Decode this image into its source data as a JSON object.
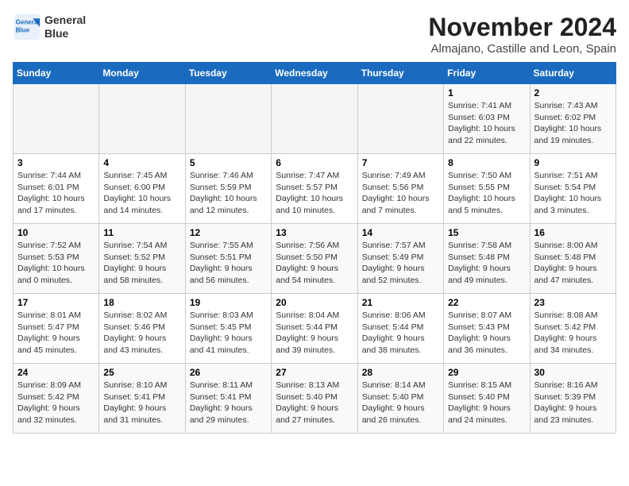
{
  "header": {
    "logo_line1": "General",
    "logo_line2": "Blue",
    "month": "November 2024",
    "location": "Almajano, Castille and Leon, Spain"
  },
  "weekdays": [
    "Sunday",
    "Monday",
    "Tuesday",
    "Wednesday",
    "Thursday",
    "Friday",
    "Saturday"
  ],
  "weeks": [
    [
      {
        "day": "",
        "info": ""
      },
      {
        "day": "",
        "info": ""
      },
      {
        "day": "",
        "info": ""
      },
      {
        "day": "",
        "info": ""
      },
      {
        "day": "",
        "info": ""
      },
      {
        "day": "1",
        "info": "Sunrise: 7:41 AM\nSunset: 6:03 PM\nDaylight: 10 hours and 22 minutes."
      },
      {
        "day": "2",
        "info": "Sunrise: 7:43 AM\nSunset: 6:02 PM\nDaylight: 10 hours and 19 minutes."
      }
    ],
    [
      {
        "day": "3",
        "info": "Sunrise: 7:44 AM\nSunset: 6:01 PM\nDaylight: 10 hours and 17 minutes."
      },
      {
        "day": "4",
        "info": "Sunrise: 7:45 AM\nSunset: 6:00 PM\nDaylight: 10 hours and 14 minutes."
      },
      {
        "day": "5",
        "info": "Sunrise: 7:46 AM\nSunset: 5:59 PM\nDaylight: 10 hours and 12 minutes."
      },
      {
        "day": "6",
        "info": "Sunrise: 7:47 AM\nSunset: 5:57 PM\nDaylight: 10 hours and 10 minutes."
      },
      {
        "day": "7",
        "info": "Sunrise: 7:49 AM\nSunset: 5:56 PM\nDaylight: 10 hours and 7 minutes."
      },
      {
        "day": "8",
        "info": "Sunrise: 7:50 AM\nSunset: 5:55 PM\nDaylight: 10 hours and 5 minutes."
      },
      {
        "day": "9",
        "info": "Sunrise: 7:51 AM\nSunset: 5:54 PM\nDaylight: 10 hours and 3 minutes."
      }
    ],
    [
      {
        "day": "10",
        "info": "Sunrise: 7:52 AM\nSunset: 5:53 PM\nDaylight: 10 hours and 0 minutes."
      },
      {
        "day": "11",
        "info": "Sunrise: 7:54 AM\nSunset: 5:52 PM\nDaylight: 9 hours and 58 minutes."
      },
      {
        "day": "12",
        "info": "Sunrise: 7:55 AM\nSunset: 5:51 PM\nDaylight: 9 hours and 56 minutes."
      },
      {
        "day": "13",
        "info": "Sunrise: 7:56 AM\nSunset: 5:50 PM\nDaylight: 9 hours and 54 minutes."
      },
      {
        "day": "14",
        "info": "Sunrise: 7:57 AM\nSunset: 5:49 PM\nDaylight: 9 hours and 52 minutes."
      },
      {
        "day": "15",
        "info": "Sunrise: 7:58 AM\nSunset: 5:48 PM\nDaylight: 9 hours and 49 minutes."
      },
      {
        "day": "16",
        "info": "Sunrise: 8:00 AM\nSunset: 5:48 PM\nDaylight: 9 hours and 47 minutes."
      }
    ],
    [
      {
        "day": "17",
        "info": "Sunrise: 8:01 AM\nSunset: 5:47 PM\nDaylight: 9 hours and 45 minutes."
      },
      {
        "day": "18",
        "info": "Sunrise: 8:02 AM\nSunset: 5:46 PM\nDaylight: 9 hours and 43 minutes."
      },
      {
        "day": "19",
        "info": "Sunrise: 8:03 AM\nSunset: 5:45 PM\nDaylight: 9 hours and 41 minutes."
      },
      {
        "day": "20",
        "info": "Sunrise: 8:04 AM\nSunset: 5:44 PM\nDaylight: 9 hours and 39 minutes."
      },
      {
        "day": "21",
        "info": "Sunrise: 8:06 AM\nSunset: 5:44 PM\nDaylight: 9 hours and 38 minutes."
      },
      {
        "day": "22",
        "info": "Sunrise: 8:07 AM\nSunset: 5:43 PM\nDaylight: 9 hours and 36 minutes."
      },
      {
        "day": "23",
        "info": "Sunrise: 8:08 AM\nSunset: 5:42 PM\nDaylight: 9 hours and 34 minutes."
      }
    ],
    [
      {
        "day": "24",
        "info": "Sunrise: 8:09 AM\nSunset: 5:42 PM\nDaylight: 9 hours and 32 minutes."
      },
      {
        "day": "25",
        "info": "Sunrise: 8:10 AM\nSunset: 5:41 PM\nDaylight: 9 hours and 31 minutes."
      },
      {
        "day": "26",
        "info": "Sunrise: 8:11 AM\nSunset: 5:41 PM\nDaylight: 9 hours and 29 minutes."
      },
      {
        "day": "27",
        "info": "Sunrise: 8:13 AM\nSunset: 5:40 PM\nDaylight: 9 hours and 27 minutes."
      },
      {
        "day": "28",
        "info": "Sunrise: 8:14 AM\nSunset: 5:40 PM\nDaylight: 9 hours and 26 minutes."
      },
      {
        "day": "29",
        "info": "Sunrise: 8:15 AM\nSunset: 5:40 PM\nDaylight: 9 hours and 24 minutes."
      },
      {
        "day": "30",
        "info": "Sunrise: 8:16 AM\nSunset: 5:39 PM\nDaylight: 9 hours and 23 minutes."
      }
    ]
  ]
}
